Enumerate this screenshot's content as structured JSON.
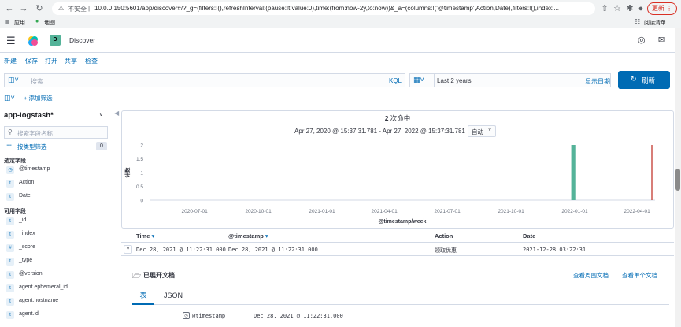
{
  "browser": {
    "security_label": "不安全",
    "url": "10.0.0.150:5601/app/discover#/?_g=(filters:!(),refreshInterval:(pause:!t,value:0),time:(from:now-2y,to:now))&_a=(columns:!('@timestamp',Action,Date),filters:!(),index:...",
    "update_label": "更新",
    "bookmarks": [
      {
        "label": "应用"
      },
      {
        "label": "地图"
      }
    ],
    "reading_list_label": "阅读清单"
  },
  "kibana": {
    "logo_letter": "D",
    "page_title": "Discover"
  },
  "toplinks": {
    "new": "新建",
    "save": "保存",
    "open": "打开",
    "share": "共享",
    "inspect": "检查"
  },
  "query": {
    "placeholder": "搜索",
    "language": "KQL",
    "time_range": "Last 2 years",
    "show_dates": "显示日期",
    "refresh_label": "刷新"
  },
  "filters": {
    "add_filter": "+ 添加筛选"
  },
  "sidebar": {
    "index_pattern": "app-logstash*",
    "search_placeholder": "搜索字段名称",
    "filter_by_type": "按类型筛选",
    "filter_count": "0",
    "selected_title": "选定字段",
    "selected_fields": [
      {
        "type": "clock",
        "name": "@timestamp"
      },
      {
        "type": "t",
        "name": "Action"
      },
      {
        "type": "t",
        "name": "Date"
      }
    ],
    "available_title": "可用字段",
    "available_fields": [
      {
        "type": "t",
        "name": "_id"
      },
      {
        "type": "t",
        "name": "_index"
      },
      {
        "type": "#",
        "name": "_score"
      },
      {
        "type": "t",
        "name": "_type"
      },
      {
        "type": "t",
        "name": "@version"
      },
      {
        "type": "t",
        "name": "agent.ephemeral_id"
      },
      {
        "type": "t",
        "name": "agent.hostname"
      },
      {
        "type": "t",
        "name": "agent.id"
      }
    ]
  },
  "hits": {
    "count": "2",
    "label": "次命中",
    "range": "Apr 27, 2020 @ 15:37:31.781 - Apr 27, 2022 @ 15:37:31.781",
    "interval": "自动"
  },
  "chart_data": {
    "type": "bar",
    "ylabel": "计数",
    "xlabel": "@timestamp/week",
    "ylim": [
      0,
      2
    ],
    "yticks": [
      "0",
      "0.5",
      "1",
      "1.5",
      "2"
    ],
    "xticks": [
      "2020-07-01",
      "2020-10-01",
      "2021-01-01",
      "2021-04-01",
      "2021-07-01",
      "2021-10-01",
      "2022-01-01",
      "2022-04-01"
    ],
    "x_domain": [
      "2020-04-27",
      "2022-04-27"
    ],
    "bars": [
      {
        "week": "2021-12-27",
        "value": 2,
        "color": "#54b399"
      }
    ],
    "now_marker": "2022-04-27",
    "now_color": "#bd271e"
  },
  "table": {
    "columns": [
      "Time",
      "@timestamp",
      "Action",
      "Date"
    ],
    "rows": [
      {
        "time": "Dec 28, 2021 @ 11:22:31.000",
        "timestamp": "Dec 28, 2021 @ 11:22:31.000",
        "action": "领取优惠",
        "date": "2021-12-28 03:22:31"
      }
    ]
  },
  "doc": {
    "title": "已展开文档",
    "view_surrounding": "查看周围文档",
    "view_single": "查看单个文档",
    "tabs": [
      "表",
      "JSON"
    ],
    "field_name": "@timestamp",
    "field_value": "Dec 28, 2021 @ 11:22:31.000"
  }
}
